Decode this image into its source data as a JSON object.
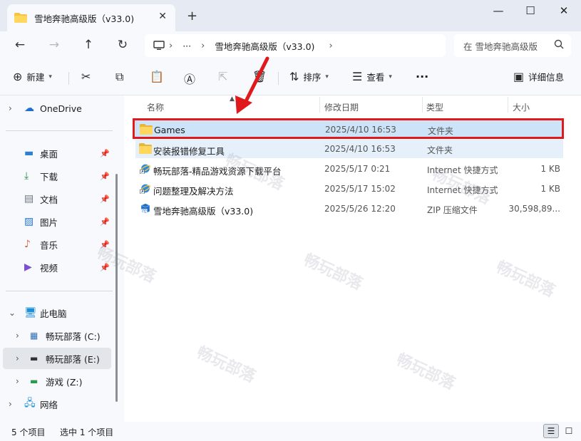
{
  "window": {
    "tab_title": "雪地奔驰高级版（v33.0)",
    "new_tab_glyph": "+",
    "close_tab_glyph": "✕",
    "minimize_glyph": "—",
    "maximize_glyph": "☐",
    "close_glyph": "✕"
  },
  "nav": {
    "back_glyph": "←",
    "forward_glyph": "→",
    "up_glyph": "↑",
    "refresh_glyph": "↻",
    "breadcrumb_more": "···",
    "breadcrumb_current": "雪地奔驰高级版（v33.0)",
    "search_placeholder": "在 雪地奔驰高级版"
  },
  "toolbar": {
    "new_label": "新建",
    "sort_label": "排序",
    "view_label": "查看",
    "more_glyph": "···",
    "details_label": "详细信息"
  },
  "sidebar": {
    "onedrive": "OneDrive",
    "quick": [
      {
        "label": "桌面",
        "icon": "desktop-icon",
        "color": "#2f7fd1"
      },
      {
        "label": "下载",
        "icon": "download-icon",
        "color": "#1f8f4e"
      },
      {
        "label": "文档",
        "icon": "document-icon",
        "color": "#6a7480"
      },
      {
        "label": "图片",
        "icon": "pictures-icon",
        "color": "#2a78d6"
      },
      {
        "label": "音乐",
        "icon": "music-icon",
        "color": "#e0643c"
      },
      {
        "label": "视频",
        "icon": "video-icon",
        "color": "#7a4fd0"
      }
    ],
    "this_pc": "此电脑",
    "drives": [
      {
        "label": "畅玩部落 (C:)"
      },
      {
        "label": "畅玩部落 (E:)"
      },
      {
        "label": "游戏 (Z:)"
      }
    ],
    "network": "网络"
  },
  "columns": {
    "name": "名称",
    "date": "修改日期",
    "type": "类型",
    "size": "大小"
  },
  "files": [
    {
      "name": "Games",
      "date": "2025/4/10 16:53",
      "type": "文件夹",
      "size": "",
      "icon": "folder-icon"
    },
    {
      "name": "安装报错修复工具",
      "date": "2025/4/10 16:53",
      "type": "文件夹",
      "size": "",
      "icon": "folder-icon"
    },
    {
      "name": "畅玩部落-精品游戏资源下载平台",
      "date": "2025/5/17 0:21",
      "type": "Internet 快捷方式",
      "size": "1 KB",
      "icon": "internet-shortcut-icon"
    },
    {
      "name": "问题整理及解决方法",
      "date": "2025/5/17 15:02",
      "type": "Internet 快捷方式",
      "size": "1 KB",
      "icon": "internet-shortcut-icon"
    },
    {
      "name": "雪地奔驰高级版（v33.0)",
      "date": "2025/5/26 12:20",
      "type": "ZIP 压缩文件",
      "size": "30,598,89...",
      "icon": "zip-icon"
    }
  ],
  "status": {
    "count": "5 个项目",
    "selected": "选中 1 个项目"
  },
  "colors": {
    "accent": "#0067c0",
    "selection": "#cde3f7",
    "annotation_red": "#e0191d",
    "folder": "#f4c542"
  }
}
